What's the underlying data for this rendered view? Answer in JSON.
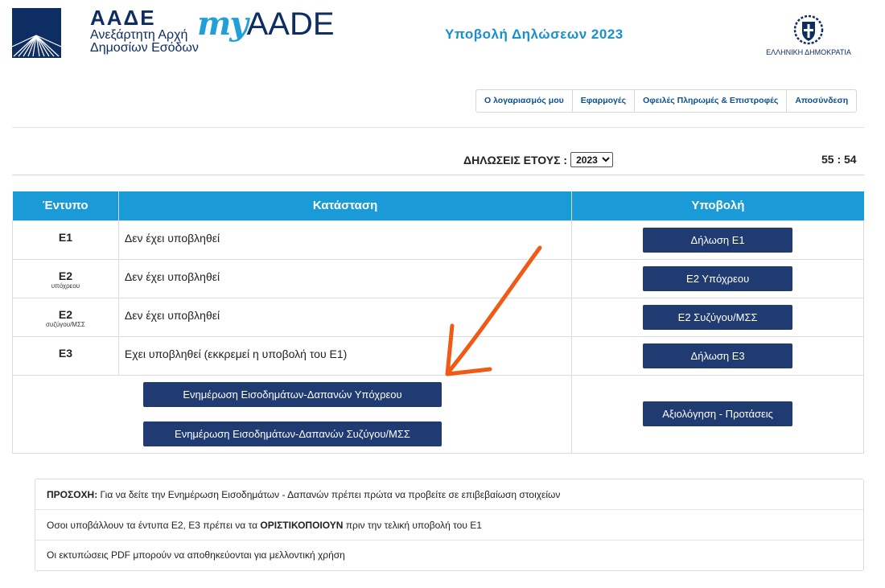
{
  "header": {
    "org_short": "ΑΑΔΕ",
    "org_line1": "Ανεξάρτητη Αρχή",
    "org_line2": "Δημοσίων Εσόδων",
    "brand_my": "my",
    "brand_aade": "AADE",
    "page_title": "Υποβολή Δηλώσεων 2023",
    "republic_label": "ΕΛΛΗΝΙΚΗ ΔΗΜΟΚΡΑΤΙΑ"
  },
  "nav": {
    "items": [
      "Ο λογαριασμός μου",
      "Εφαρμογές",
      "Οφειλές Πληρωμές & Επιστροφές",
      "Αποσύνδεση"
    ]
  },
  "year_filter": {
    "label": "ΔΗΛΩΣΕΙΣ ΕΤΟΥΣ :",
    "selected": "2023",
    "options": [
      "2023"
    ]
  },
  "timer": "55 : 54",
  "table": {
    "headers": [
      "Έντυπο",
      "Κατάσταση",
      "Υποβολή"
    ],
    "rows": [
      {
        "form": "Ε1",
        "form_sub": "",
        "status": "Δεν έχει υποβληθεί",
        "action": "Δήλωση Ε1"
      },
      {
        "form": "Ε2",
        "form_sub": "υπόχρεου",
        "status": "Δεν έχει υποβληθεί",
        "action": "Ε2 Υπόχρεου"
      },
      {
        "form": "Ε2",
        "form_sub": "συζύγου/ΜΣΣ",
        "status": "Δεν έχει υποβληθεί",
        "action": "Ε2 Συζύγου/ΜΣΣ"
      },
      {
        "form": "Ε3",
        "form_sub": "",
        "status": "Εχει υποβληθεί (εκκρεμεί η υποβολή του Ε1)",
        "action": "Δήλωση Ε3"
      }
    ],
    "update_taxpayer": "Ενημέρωση Εισοδημάτων-Δαπανών Υπόχρεου",
    "update_spouse": "Ενημέρωση Εισοδημάτων-Δαπανών Συζύγου/ΜΣΣ",
    "feedback": "Αξιολόγηση - Προτάσεις"
  },
  "notes": {
    "n1_bold": "ΠΡΟΣΟΧΗ:",
    "n1_text": " Για να δείτε την Ενημέρωση Εισοδημάτων - Δαπανών πρέπει πρώτα να προβείτε σε επιβεβαίωση στοιχείων",
    "n2_pre": "Οσοι υποβάλλουν τα έντυπα Ε2, Ε3 πρέπει να τα ",
    "n2_bold": "ΟΡΙΣΤΙΚΟΠΟΙΟΥΝ",
    "n2_post": " πριν την τελική υποβολή του Ε1",
    "n3": "Οι εκτυπώσεις PDF μπορούν να αποθηκεύονται για μελλοντική χρήση"
  },
  "colors": {
    "header_blue": "#1a9ad6",
    "button_navy": "#1f3b72",
    "annotation_arrow": "#f05a14"
  }
}
